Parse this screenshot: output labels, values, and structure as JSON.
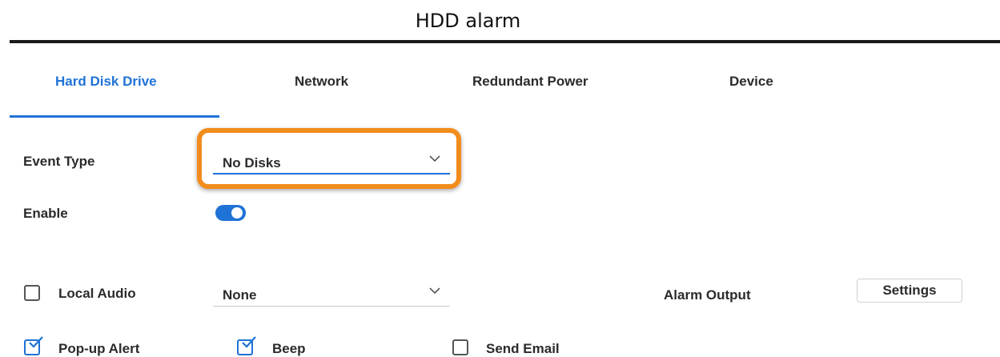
{
  "page": {
    "title": "HDD alarm"
  },
  "tabs": [
    {
      "label": "Hard Disk Drive",
      "active": true
    },
    {
      "label": "Network",
      "active": false
    },
    {
      "label": "Redundant Power",
      "active": false
    },
    {
      "label": "Device",
      "active": false
    }
  ],
  "form": {
    "event_type_label": "Event Type",
    "event_type_value": "No Disks",
    "enable_label": "Enable",
    "enable_on": true,
    "local_audio_label": "Local Audio",
    "local_audio_checked": false,
    "audio_value": "None",
    "alarm_output_label": "Alarm Output",
    "settings_label": "Settings",
    "popup_alert_label": "Pop-up Alert",
    "popup_alert_checked": true,
    "beep_label": "Beep",
    "beep_checked": true,
    "send_email_label": "Send Email",
    "send_email_checked": false
  },
  "colors": {
    "accent": "#1f72d6",
    "highlight": "#f28c1c"
  },
  "icons": {
    "select_chevron": "chevron-down-icon",
    "checkmark": "checkmark-icon"
  }
}
